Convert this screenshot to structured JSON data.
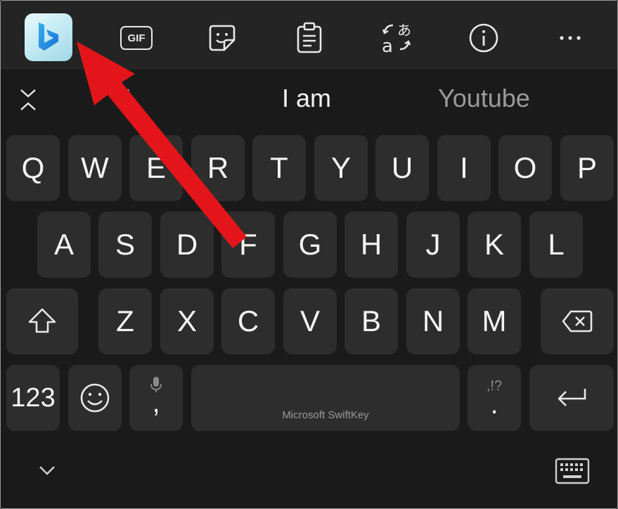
{
  "toolbar": {
    "gif_label": "GIF"
  },
  "suggestions": {
    "left": "I",
    "center": "I am",
    "right": "Youtube"
  },
  "keyboard": {
    "row1": [
      "Q",
      "W",
      "E",
      "R",
      "T",
      "Y",
      "U",
      "I",
      "O",
      "P"
    ],
    "row2": [
      "A",
      "S",
      "D",
      "F",
      "G",
      "H",
      "J",
      "K",
      "L"
    ],
    "row3": [
      "Z",
      "X",
      "C",
      "V",
      "B",
      "N",
      "M"
    ],
    "numbers_key": "123",
    "comma_key": ",",
    "period_key": ".",
    "punct_hint": ",!?",
    "spacebar_label": "Microsoft SwiftKey"
  },
  "icons": [
    "bing-icon",
    "gif-icon",
    "sticker-icon",
    "clipboard-icon",
    "translate-icon",
    "info-icon",
    "more-icon",
    "collapse-icon",
    "shift-icon",
    "backspace-icon",
    "emoji-icon",
    "mic-icon",
    "enter-icon",
    "chevron-down-icon",
    "keyboard-icon"
  ],
  "colors": {
    "background": "#1a1a1a",
    "toolbar": "#242424",
    "key": "#2d2d2d",
    "key_text": "#f4f4f4",
    "annotation_arrow": "#e3151a"
  }
}
